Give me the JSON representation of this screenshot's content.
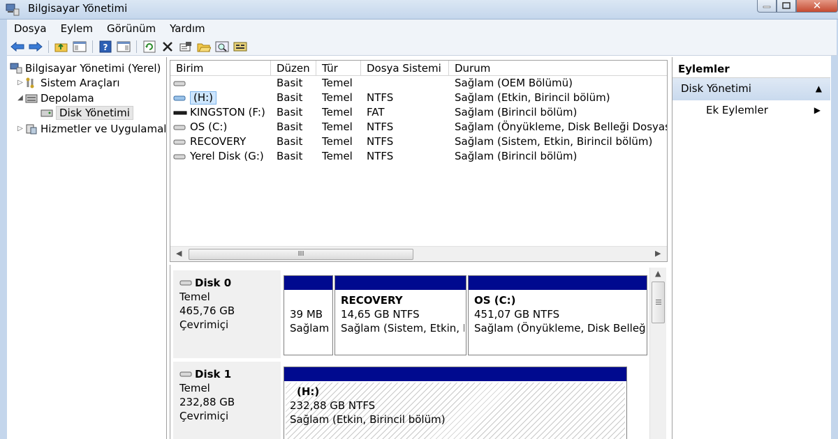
{
  "window": {
    "title": "Bilgisayar Yönetimi",
    "close_glyph": "✕"
  },
  "menu": [
    "Dosya",
    "Eylem",
    "Görünüm",
    "Yardım"
  ],
  "toolbar_icons": [
    "back-icon",
    "forward-icon",
    "up-folder-icon",
    "show-hide-tree-icon",
    "help-icon",
    "show-hide-action-icon",
    "refresh-icon",
    "delete-icon",
    "properties-icon",
    "open-icon",
    "search-icon",
    "disk-settings-icon"
  ],
  "tree": {
    "root": "Bilgisayar Yönetimi (Yerel)",
    "system_tools": "Sistem Araçları",
    "storage": "Depolama",
    "disk_management": "Disk Yönetimi",
    "services": "Hizmetler ve Uygulamalar"
  },
  "volume_list": {
    "columns": [
      "Birim",
      "Düzen",
      "Tür",
      "Dosya Sistemi",
      "Durum"
    ],
    "rows": [
      {
        "name": "",
        "layout": "Basit",
        "type": "Temel",
        "fs": "",
        "status": "Sağlam (OEM Bölümü)"
      },
      {
        "name": "(H:)",
        "layout": "Basit",
        "type": "Temel",
        "fs": "NTFS",
        "status": "Sağlam (Etkin, Birincil bölüm)"
      },
      {
        "name": "KINGSTON (F:)",
        "layout": "Basit",
        "type": "Temel",
        "fs": "FAT",
        "status": "Sağlam (Birincil bölüm)"
      },
      {
        "name": "OS (C:)",
        "layout": "Basit",
        "type": "Temel",
        "fs": "NTFS",
        "status": "Sağlam (Önyükleme, Disk Belleği Dosyası)"
      },
      {
        "name": "RECOVERY",
        "layout": "Basit",
        "type": "Temel",
        "fs": "NTFS",
        "status": "Sağlam (Sistem, Etkin, Birincil bölüm)"
      },
      {
        "name": "Yerel Disk (G:)",
        "layout": "Basit",
        "type": "Temel",
        "fs": "NTFS",
        "status": "Sağlam (Birincil bölüm)"
      }
    ],
    "hscroll_grip": "III"
  },
  "disks": [
    {
      "name": "Disk 0",
      "kind": "Temel",
      "size": "465,76 GB",
      "state": "Çevrimiçi",
      "partitions": [
        {
          "name": "",
          "size": "39 MB",
          "status": "Sağlam (OEM Bölümü)"
        },
        {
          "name": "RECOVERY",
          "size": "14,65 GB NTFS",
          "status": "Sağlam (Sistem, Etkin, Birincil bölüm)"
        },
        {
          "name": "OS  (C:)",
          "size": "451,07 GB NTFS",
          "status": "Sağlam (Önyükleme, Disk Belleği Dosyası)"
        }
      ]
    },
    {
      "name": "Disk 1",
      "kind": "Temel",
      "size": "232,88 GB",
      "state": "Çevrimiçi",
      "partitions": [
        {
          "name": "(H:)",
          "size": "232,88 GB NTFS",
          "status": "Sağlam (Etkin, Birincil bölüm)"
        }
      ]
    }
  ],
  "actions": {
    "header": "Eylemler",
    "section": "Disk Yönetimi",
    "more": "Ek Eylemler"
  },
  "colors": {
    "partition_bar": "#000a8f",
    "selection": "#cde6ff",
    "frame": "#c4d6ec"
  }
}
